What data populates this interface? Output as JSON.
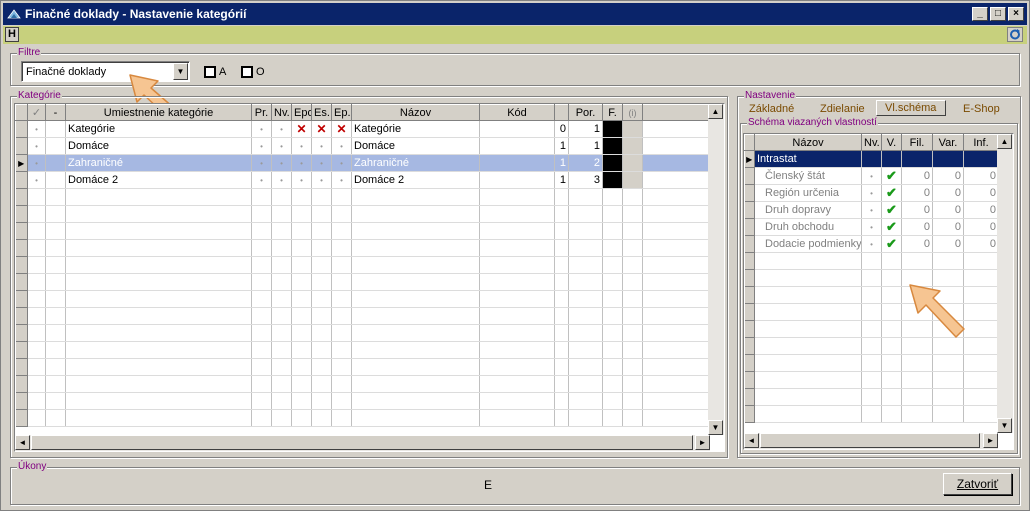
{
  "window": {
    "title": "Finačné doklady - Nastavenie kategórií",
    "minimize": "_",
    "maximize": "□",
    "close": "×"
  },
  "toolbar": {
    "h_label": "H"
  },
  "filter": {
    "legend": "Filtre",
    "combo_value": "Finačné doklady",
    "check_a": "A",
    "check_o": "O"
  },
  "categories": {
    "legend": "Kategórie",
    "columns": [
      "✓",
      "-",
      "Umiestnenie kategórie",
      "Pr.",
      "Nv.",
      "Epo",
      "Es.",
      "Ep.",
      "Názov",
      "Kód",
      "",
      "Por.",
      "F.",
      "(i)"
    ],
    "rows": [
      {
        "umiestnenie": "Kategórie",
        "nazov": "Kategórie",
        "kod_level": "0",
        "por": "1"
      },
      {
        "umiestnenie": "Domáce",
        "nazov": "Domáce",
        "kod_level": "1",
        "por": "1"
      },
      {
        "umiestnenie": "Zahraničné",
        "nazov": "Zahraničné",
        "kod_level": "1",
        "por": "2"
      },
      {
        "umiestnenie": "Domáce 2",
        "nazov": "Domáce 2",
        "kod_level": "1",
        "por": "3"
      }
    ]
  },
  "settings": {
    "legend": "Nastavenie",
    "tabs": [
      "Základné",
      "Zdielanie",
      "Vl.schéma",
      "E-Shop"
    ],
    "schema_legend": "Schéma viazaných vlastností",
    "columns": [
      "Názov",
      "Nv.",
      "V.",
      "Fil.",
      "Var.",
      "Inf."
    ],
    "parent": "Intrastat",
    "rows": [
      {
        "nazov": "Členský štát",
        "fil": "0",
        "var": "0",
        "inf": "0"
      },
      {
        "nazov": "Región určenia",
        "fil": "0",
        "var": "0",
        "inf": "0"
      },
      {
        "nazov": "Druh dopravy",
        "fil": "0",
        "var": "0",
        "inf": "0"
      },
      {
        "nazov": "Druh obchodu",
        "fil": "0",
        "var": "0",
        "inf": "0"
      },
      {
        "nazov": "Dodacie podmienky",
        "fil": "0",
        "var": "0",
        "inf": "0"
      }
    ]
  },
  "actions": {
    "legend": "Úkony",
    "center_label": "E",
    "close_button": "Zatvoriť"
  }
}
